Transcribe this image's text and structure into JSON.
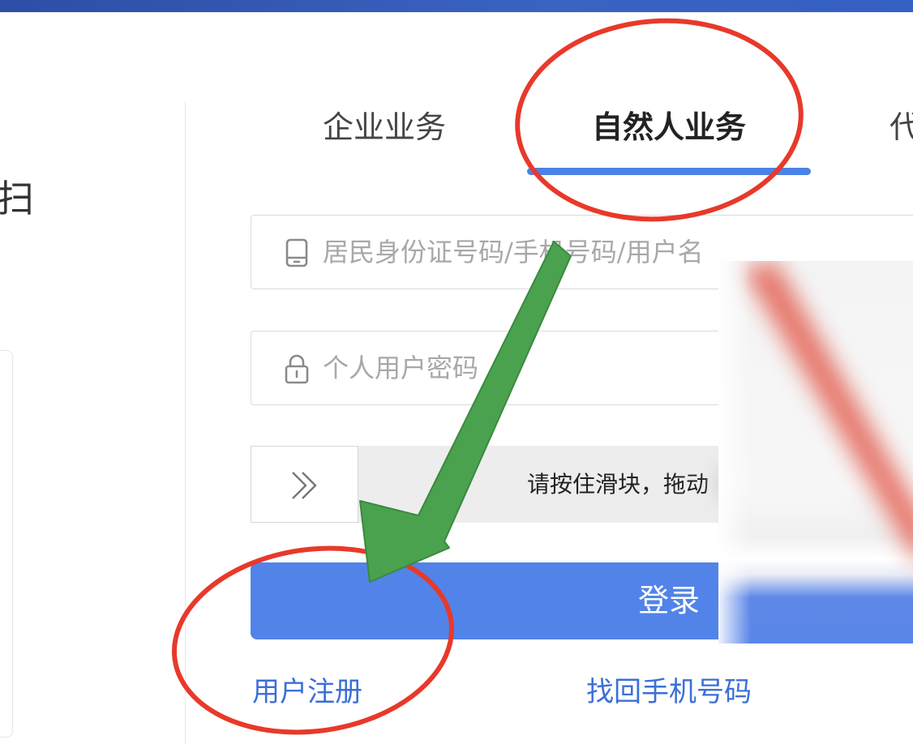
{
  "left_panel": {
    "scan_text": "扫"
  },
  "tabs": [
    {
      "label": "企业业务",
      "active": false
    },
    {
      "label": "自然人业务",
      "active": true
    },
    {
      "label": "代",
      "active": false
    }
  ],
  "form": {
    "account": {
      "placeholder": "居民身份证号码/手机号码/用户名",
      "value": "",
      "icon": "mobile-phone-icon"
    },
    "password": {
      "placeholder": "个人用户密码",
      "value": "",
      "icon": "lock-icon"
    },
    "slider": {
      "hint": "请按住滑块，拖动",
      "icon": "double-chevron-right-icon"
    },
    "login_label": "登录"
  },
  "links": {
    "register": "用户注册",
    "recover_phone": "找回手机号码"
  },
  "colors": {
    "top_bar": "#3560c4",
    "primary": "#5283e8",
    "link": "#3b6fd8",
    "annotation_red": "#e8392a",
    "annotation_green": "#4aa14e"
  }
}
